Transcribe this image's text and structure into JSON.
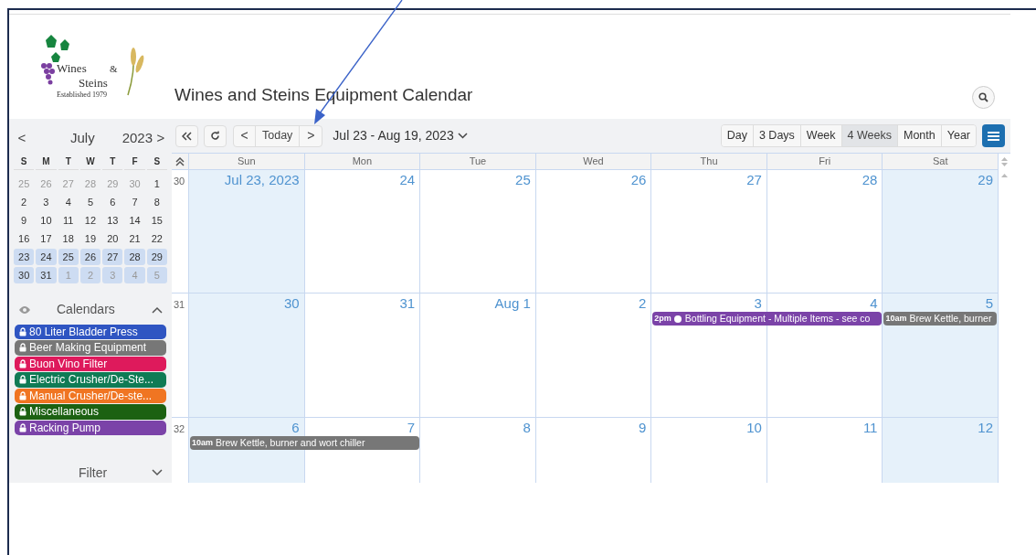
{
  "logo": {
    "line_1": "Wines",
    "ampersand": "&",
    "line_2": "Steins",
    "tagline": "Established 1979"
  },
  "title": "Wines and Steins Equipment Calendar",
  "mini_calendar": {
    "prev": "<",
    "month": "July",
    "year": "2023",
    "next": ">",
    "weekdays": [
      "S",
      "M",
      "T",
      "W",
      "T",
      "F",
      "S"
    ],
    "days": [
      {
        "label": "25",
        "muted": true,
        "selected": false
      },
      {
        "label": "26",
        "muted": true,
        "selected": false
      },
      {
        "label": "27",
        "muted": true,
        "selected": false
      },
      {
        "label": "28",
        "muted": true,
        "selected": false
      },
      {
        "label": "29",
        "muted": true,
        "selected": false
      },
      {
        "label": "30",
        "muted": true,
        "selected": false
      },
      {
        "label": "1",
        "muted": false,
        "selected": false
      },
      {
        "label": "2",
        "muted": false,
        "selected": false
      },
      {
        "label": "3",
        "muted": false,
        "selected": false
      },
      {
        "label": "4",
        "muted": false,
        "selected": false
      },
      {
        "label": "5",
        "muted": false,
        "selected": false
      },
      {
        "label": "6",
        "muted": false,
        "selected": false
      },
      {
        "label": "7",
        "muted": false,
        "selected": false
      },
      {
        "label": "8",
        "muted": false,
        "selected": false
      },
      {
        "label": "9",
        "muted": false,
        "selected": false
      },
      {
        "label": "10",
        "muted": false,
        "selected": false
      },
      {
        "label": "11",
        "muted": false,
        "selected": false
      },
      {
        "label": "12",
        "muted": false,
        "selected": false
      },
      {
        "label": "13",
        "muted": false,
        "selected": false
      },
      {
        "label": "14",
        "muted": false,
        "selected": false
      },
      {
        "label": "15",
        "muted": false,
        "selected": false
      },
      {
        "label": "16",
        "muted": false,
        "selected": false
      },
      {
        "label": "17",
        "muted": false,
        "selected": false
      },
      {
        "label": "18",
        "muted": false,
        "selected": false
      },
      {
        "label": "19",
        "muted": false,
        "selected": false
      },
      {
        "label": "20",
        "muted": false,
        "selected": false
      },
      {
        "label": "21",
        "muted": false,
        "selected": false
      },
      {
        "label": "22",
        "muted": false,
        "selected": false
      },
      {
        "label": "23",
        "muted": false,
        "selected": true
      },
      {
        "label": "24",
        "muted": false,
        "selected": true
      },
      {
        "label": "25",
        "muted": false,
        "selected": true
      },
      {
        "label": "26",
        "muted": false,
        "selected": true
      },
      {
        "label": "27",
        "muted": false,
        "selected": true
      },
      {
        "label": "28",
        "muted": false,
        "selected": true
      },
      {
        "label": "29",
        "muted": false,
        "selected": true
      },
      {
        "label": "30",
        "muted": false,
        "selected": true
      },
      {
        "label": "31",
        "muted": false,
        "selected": true
      },
      {
        "label": "1",
        "muted": true,
        "selected": true
      },
      {
        "label": "2",
        "muted": true,
        "selected": true
      },
      {
        "label": "3",
        "muted": true,
        "selected": true
      },
      {
        "label": "4",
        "muted": true,
        "selected": true
      },
      {
        "label": "5",
        "muted": true,
        "selected": true
      }
    ]
  },
  "calendars": {
    "title": "Calendars",
    "items": [
      {
        "name": "80 Liter Bladder Press",
        "color": "#2f55c2"
      },
      {
        "name": "Beer Making Equipment",
        "color": "#777777"
      },
      {
        "name": "Buon Vino Filter",
        "color": "#de1a5c"
      },
      {
        "name": "Electric Crusher/De-Ste...",
        "color": "#0f7b55"
      },
      {
        "name": "Manual Crusher/De-ste...",
        "color": "#f07522"
      },
      {
        "name": "Miscellaneous",
        "color": "#1c6112"
      },
      {
        "name": "Racking Pump",
        "color": "#7b43a8"
      }
    ]
  },
  "filter": {
    "title": "Filter"
  },
  "toolbar": {
    "today": "Today",
    "prev": "<",
    "next": ">",
    "range": "Jul 23 - Aug 19, 2023",
    "views": [
      {
        "label": "Day",
        "selected": false
      },
      {
        "label": "3 Days",
        "selected": false
      },
      {
        "label": "Week",
        "selected": false
      },
      {
        "label": "4 Weeks",
        "selected": true
      },
      {
        "label": "Month",
        "selected": false
      },
      {
        "label": "Year",
        "selected": false
      }
    ]
  },
  "weekdays": [
    "Sun",
    "Mon",
    "Tue",
    "Wed",
    "Thu",
    "Fri",
    "Sat"
  ],
  "weeks": [
    {
      "number": "30",
      "days": [
        {
          "label": "Jul 23, 2023",
          "shaded": true
        },
        {
          "label": "24",
          "shaded": false
        },
        {
          "label": "25",
          "shaded": false
        },
        {
          "label": "26",
          "shaded": false
        },
        {
          "label": "27",
          "shaded": false
        },
        {
          "label": "28",
          "shaded": false
        },
        {
          "label": "29",
          "shaded": true
        }
      ]
    },
    {
      "number": "31",
      "days": [
        {
          "label": "30",
          "shaded": true
        },
        {
          "label": "31",
          "shaded": false
        },
        {
          "label": "Aug 1",
          "shaded": false
        },
        {
          "label": "2",
          "shaded": false
        },
        {
          "label": "3",
          "shaded": false,
          "events": [
            {
              "time": "2pm",
              "title": "Bottling Equipment - Multiple Items - see co",
              "color": "#7b43a8",
              "has_note": true,
              "spans_next_day": true
            }
          ]
        },
        {
          "label": "4",
          "shaded": false
        },
        {
          "label": "5",
          "shaded": true,
          "events": [
            {
              "time": "10am",
              "title": "Brew Kettle, burner",
              "color": "#777777",
              "has_note": false,
              "spans_next_day": false
            }
          ]
        }
      ]
    },
    {
      "number": "32",
      "days": [
        {
          "label": "6",
          "shaded": true,
          "events": [
            {
              "time": "10am",
              "title": "Brew Kettle, burner and wort chiller",
              "color": "#777777",
              "has_note": false,
              "spans_next_day": true
            }
          ]
        },
        {
          "label": "7",
          "shaded": false
        },
        {
          "label": "8",
          "shaded": false
        },
        {
          "label": "9",
          "shaded": false
        },
        {
          "label": "10",
          "shaded": false
        },
        {
          "label": "11",
          "shaded": false
        },
        {
          "label": "12",
          "shaded": true
        }
      ]
    }
  ]
}
